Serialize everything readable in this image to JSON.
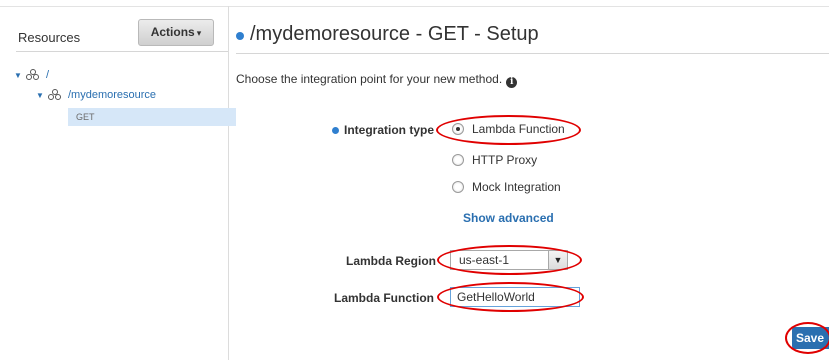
{
  "resources_pane": {
    "title": "Resources",
    "actions_label": "Actions",
    "tree": {
      "root": "/",
      "child": "/mydemoresource",
      "method": "GET"
    }
  },
  "main": {
    "title": "/mydemoresource - GET - Setup",
    "intro": "Choose the integration point for your new method.",
    "integration_type_label": "Integration type",
    "integration_options": [
      "Lambda Function",
      "HTTP Proxy",
      "Mock Integration"
    ],
    "selected_option": "Lambda Function",
    "show_advanced": "Show advanced",
    "lambda_region_label": "Lambda Region",
    "lambda_region_value": "us-east-1",
    "lambda_function_label": "Lambda Function",
    "lambda_function_value": "GetHelloWorld",
    "save_label": "Save"
  },
  "colors": {
    "accent_blue": "#2a6fb0",
    "annotation_red": "#e00000",
    "selected_row": "#d6e7f8"
  },
  "icons": [
    "resource-icon",
    "info-icon",
    "dropdown-arrow-icon",
    "expand-triangle-icon"
  ]
}
